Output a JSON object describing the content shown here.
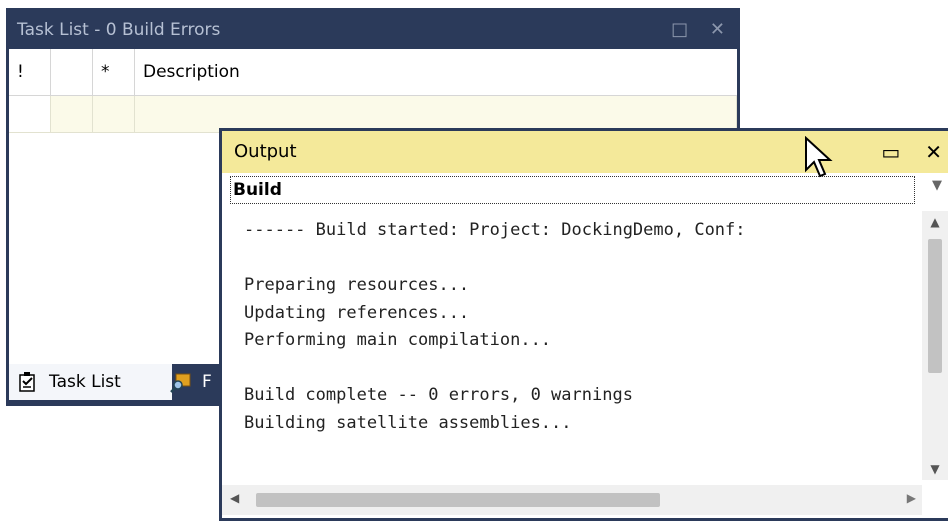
{
  "task_list": {
    "title": "Task List - 0 Build Errors",
    "columns": [
      "!",
      "",
      "*",
      "Description"
    ],
    "tabs": [
      {
        "label": "Task List",
        "icon": "task-list-icon"
      },
      {
        "label": "F",
        "icon": "find-results-icon"
      }
    ]
  },
  "output": {
    "title": "Output",
    "source": "Build",
    "lines": [
      "------ Build started: Project: DockingDemo, Conf:",
      "",
      "Preparing resources...",
      "Updating references...",
      "Performing main compilation...",
      "",
      "Build complete -- 0 errors, 0 warnings",
      "Building satellite assemblies..."
    ]
  },
  "colors": {
    "frame": "#2b3a5a",
    "active_title": "#f4e99a",
    "row_highlight": "#fbfae9"
  }
}
